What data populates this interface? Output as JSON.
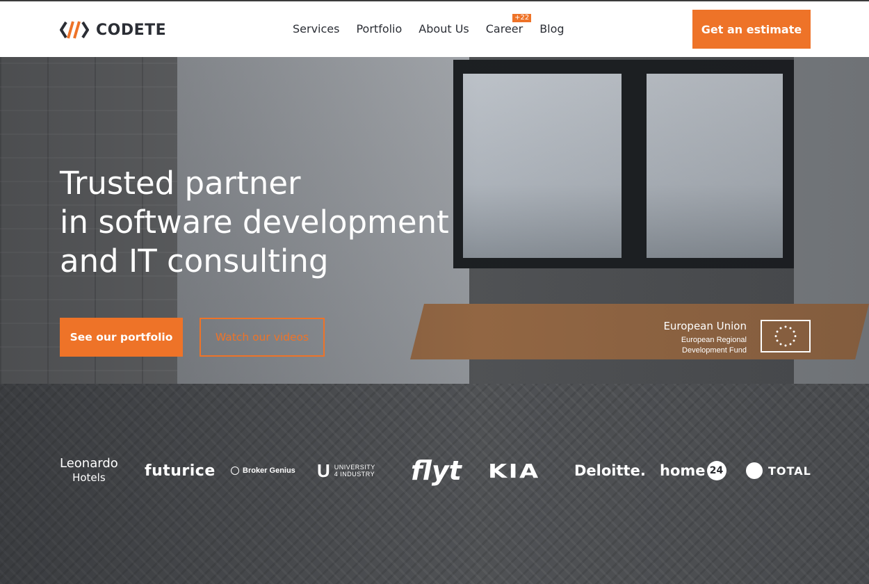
{
  "brand": {
    "name": "CODETE",
    "accent": "#ee7328",
    "dark": "#2b2e35"
  },
  "nav": {
    "items": [
      {
        "label": "Services"
      },
      {
        "label": "Portfolio"
      },
      {
        "label": "About Us"
      },
      {
        "label": "Career",
        "badge": "+22"
      },
      {
        "label": "Blog"
      }
    ],
    "cta": "Get an estimate"
  },
  "hero": {
    "title_lines": [
      "Trusted partner",
      "in software development",
      "and IT consulting"
    ],
    "primary_button": "See our portfolio",
    "secondary_button": "Watch our videos"
  },
  "eu": {
    "title": "European Union",
    "sub1": "European Regional",
    "sub2": "Development Fund"
  },
  "clients": {
    "leonardo_1": "Leonardo",
    "leonardo_2": "Hotels",
    "futurice": "futurice",
    "broker": "Broker Genius",
    "u4i_1": "UNIVERSITY",
    "u4i_2": "4 INDUSTRY",
    "flyt": "flyt",
    "kia": "KIA",
    "deloitte": "Deloitte.",
    "home": "home",
    "home_num": "24",
    "total": "TOTAL"
  }
}
